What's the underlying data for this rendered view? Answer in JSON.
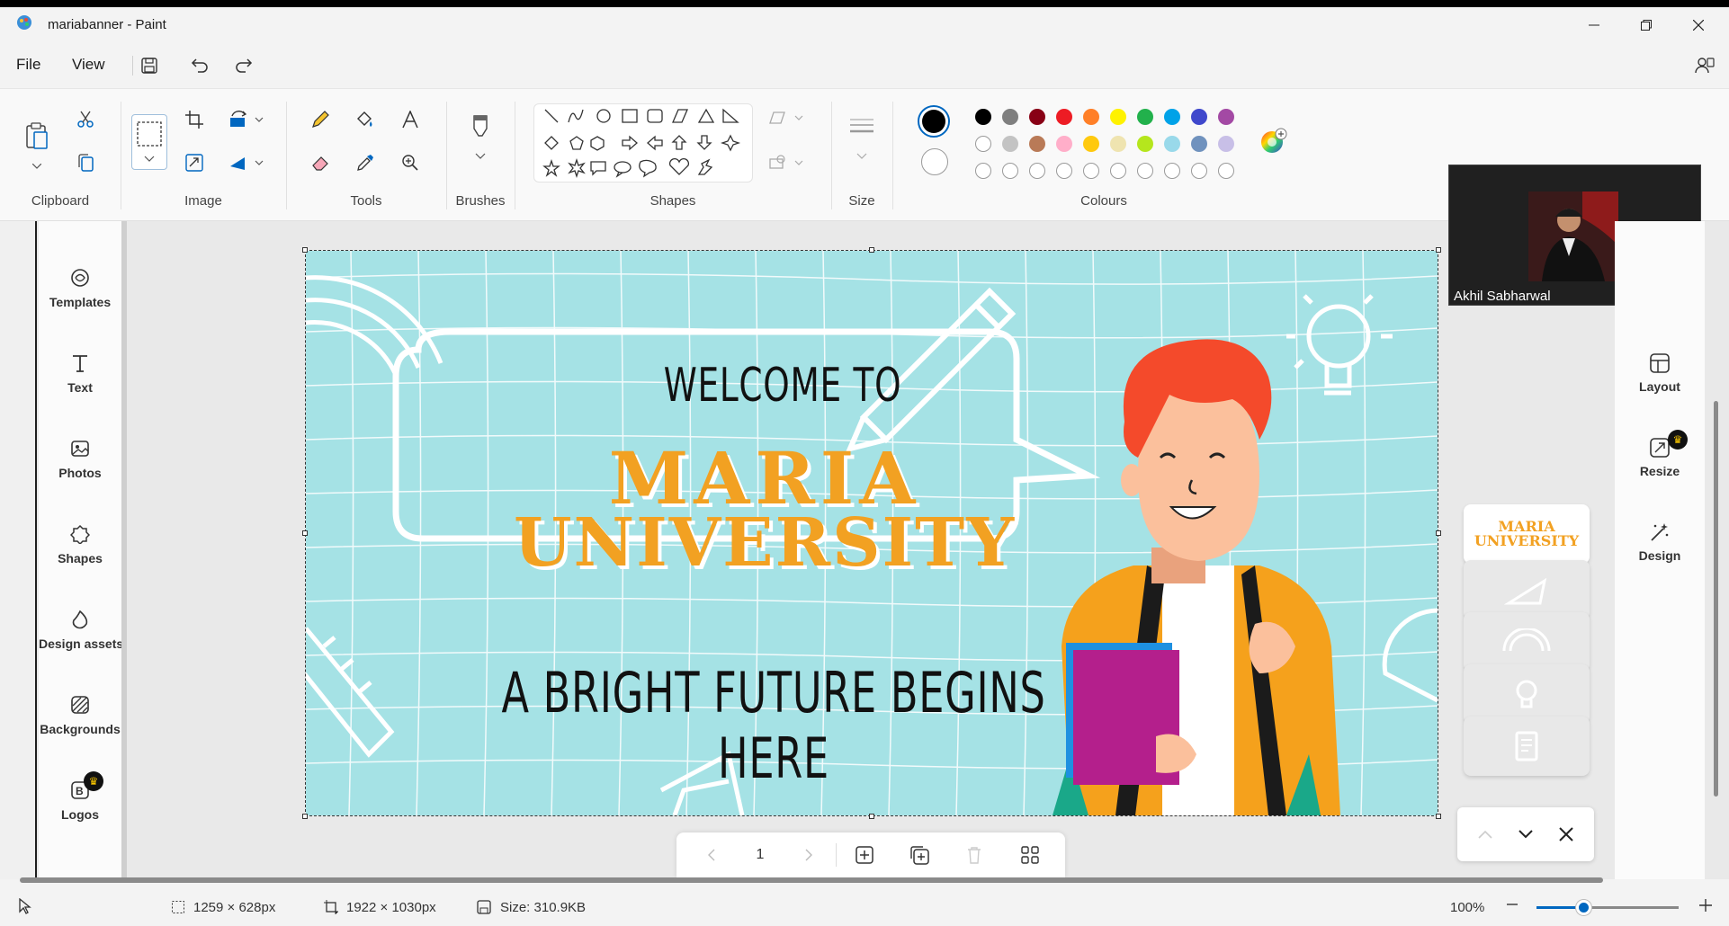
{
  "window": {
    "title": "mariabanner - Paint"
  },
  "menu": {
    "file": "File",
    "view": "View"
  },
  "ribbon": {
    "groups": {
      "clipboard": "Clipboard",
      "image": "Image",
      "tools": "Tools",
      "brushes": "Brushes",
      "shapes": "Shapes",
      "size": "Size",
      "colours": "Colours"
    },
    "primary_color": "#000000",
    "secondary_color": "#ffffff",
    "palette_row1": [
      "#000000",
      "#7f7f7f",
      "#880015",
      "#ed1c24",
      "#ff7f27",
      "#fff200",
      "#22b14c",
      "#00a2e8",
      "#3f48cc",
      "#a349a4"
    ],
    "palette_row2": [
      "#ffffff",
      "#c3c3c3",
      "#b97a57",
      "#ffaec9",
      "#ffc90e",
      "#efe4b0",
      "#b5e61d",
      "#99d9ea",
      "#7092be",
      "#c8bfe7"
    ]
  },
  "left_panel": {
    "items": [
      {
        "label": "Templates",
        "icon": "templates-icon"
      },
      {
        "label": "Text",
        "icon": "text-icon"
      },
      {
        "label": "Photos",
        "icon": "photos-icon"
      },
      {
        "label": "Shapes",
        "icon": "shapes-icon"
      },
      {
        "label": "Design assets",
        "icon": "design-assets-icon"
      },
      {
        "label": "Backgrounds",
        "icon": "backgrounds-icon"
      },
      {
        "label": "Logos",
        "icon": "logos-icon",
        "premium": true
      }
    ]
  },
  "right_panel": {
    "items": [
      {
        "label": "Layout",
        "icon": "layout-icon"
      },
      {
        "label": "Resize",
        "icon": "resize-icon",
        "premium": true
      },
      {
        "label": "Design",
        "icon": "design-icon"
      }
    ]
  },
  "canvas": {
    "welcome": "WELCOME TO",
    "line1": "MARIA",
    "line2": "UNIVERSITY",
    "tagline": "A BRIGHT FUTURE BEGINS HERE",
    "background": "#a5e2e5",
    "accent": "#f2a122"
  },
  "pagenav": {
    "page": "1"
  },
  "thumbnails": {
    "active_text_1": "MARIA",
    "active_text_2": "UNIVERSITY"
  },
  "video": {
    "name": "Akhil Sabharwal"
  },
  "status": {
    "selection_size": "1259 × 628px",
    "canvas_size": "1922 × 1030px",
    "file_size": "Size: 310.9KB",
    "zoom": "100%",
    "zoom_fraction": 0.33
  }
}
